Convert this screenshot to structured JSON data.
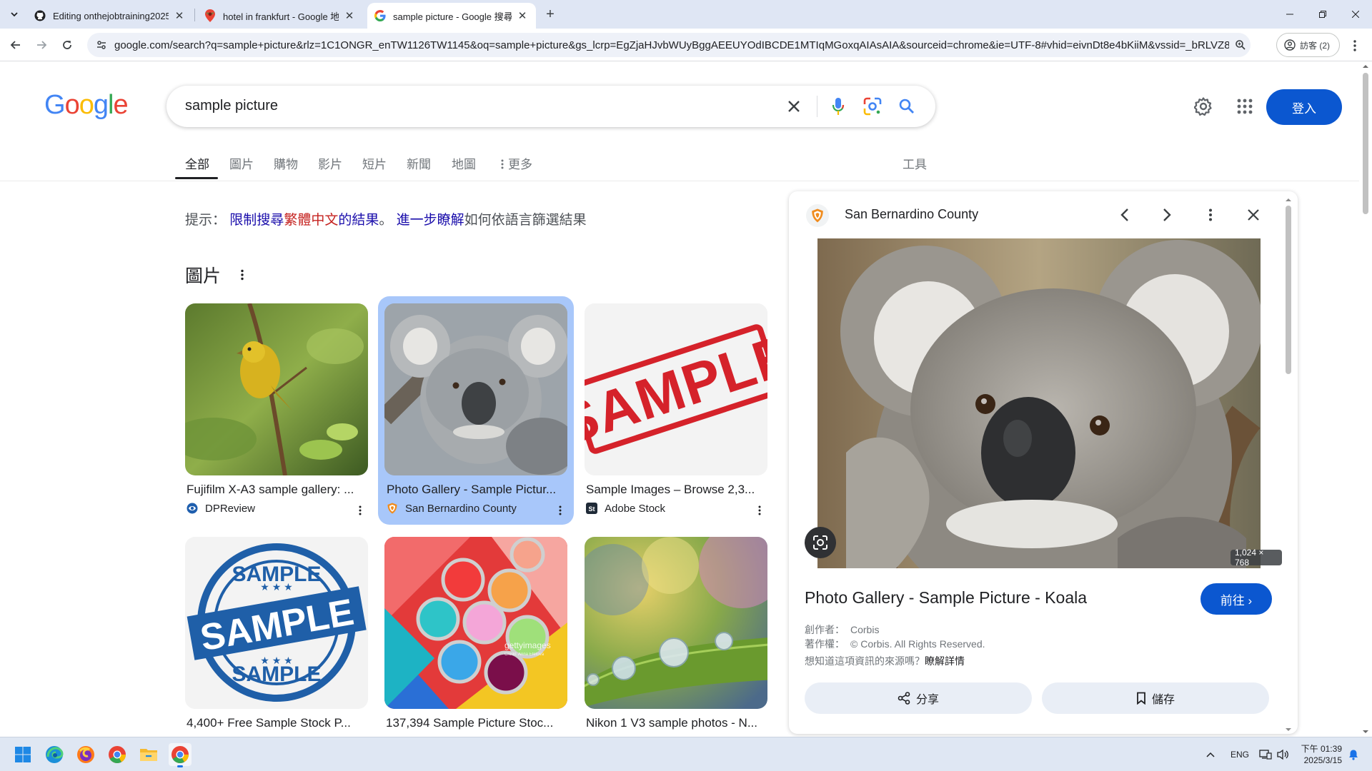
{
  "browser": {
    "tabs": [
      {
        "title": "Editing onthejobtraining2025",
        "icon": "github-icon"
      },
      {
        "title": "hotel in frankfurt - Google 地圖",
        "icon": "maps-pin-icon"
      },
      {
        "title": "sample picture - Google 搜尋",
        "icon": "google-g-icon",
        "active": true
      }
    ],
    "url": "google.com/search?q=sample+picture&rlz=1C1ONGR_enTW1126TW1145&oq=sample+picture&gs_lcrp=EgZjaHJvbWUyBggAEEUYOdIBCDE1MTIqMGoxqAIAsAIA&sourceid=chrome&ie=UTF-8#vhid=eivnDt8e4bKiiM&vssid=_bRLVZ8fr...",
    "profile_label": "訪客 (2)"
  },
  "google": {
    "logo": "Google",
    "query": "sample picture",
    "signin_label": "登入",
    "tabs": [
      "全部",
      "圖片",
      "購物",
      "影片",
      "短片",
      "新聞",
      "地圖",
      "更多"
    ],
    "tools_label": "工具",
    "hint": {
      "prefix": "提示：",
      "link1_a": "限制搜尋",
      "link1_red": "繁體中文",
      "link1_b": "的結果",
      "sep": "。",
      "link2": "進一步瞭解",
      "suffix": "如何依語言篩選結果"
    },
    "images_heading": "圖片",
    "image_results": [
      {
        "title": "Fujifilm X-A3 sample gallery: ...",
        "source": "DPReview",
        "thumb": "yellow-bird"
      },
      {
        "title": "Photo Gallery - Sample Pictur...",
        "source": "San Bernardino County",
        "thumb": "koala",
        "selected": true
      },
      {
        "title": "Sample Images – Browse 2,3...",
        "source": "Adobe Stock",
        "thumb": "sample-stamp-red"
      },
      {
        "title": "4,400+ Free Sample Stock P...",
        "source": "",
        "thumb": "sample-stamp-blue"
      },
      {
        "title": "137,394 Sample Picture Stoc...",
        "source": "",
        "thumb": "paint-cans"
      },
      {
        "title": "Nikon 1 V3 sample photos - N...",
        "source": "",
        "thumb": "water-drops"
      }
    ],
    "thumb_texts": {
      "stamp_red": "SAMPLE",
      "stamp_blue_top": "SAMPLE",
      "stamp_blue_mid": "SAMPLE",
      "stamp_blue_bottom": "SAMPLE",
      "getty": "gettyimages",
      "getty_credit": "Credit: Anna Efetova"
    }
  },
  "panel": {
    "source_name": "San Bernardino County",
    "dimensions": "1,024 × 768",
    "title": "Photo Gallery - Sample Picture - Koala",
    "visit_label": "前往 ›",
    "creator_label": "創作者：",
    "creator": "Corbis",
    "copyright_label": "著作權：",
    "copyright": "© Corbis. All Rights Reserved.",
    "info_question": "想知道這項資訊的來源嗎？",
    "info_link": "瞭解詳情",
    "share_label": "分享",
    "save_label": "儲存"
  },
  "taskbar": {
    "language": "ENG",
    "time": "下午 01:39",
    "date": "2025/3/15"
  },
  "colors": {
    "accent_blue": "#0b57d0",
    "selected_card": "#a8c7fa",
    "link": "#1a0dab"
  }
}
